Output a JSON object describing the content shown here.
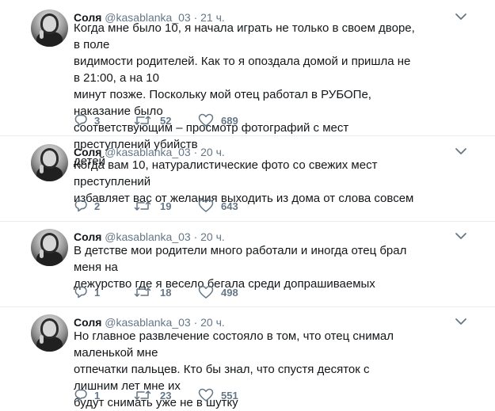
{
  "tweets": [
    {
      "author_name": "Соля",
      "handle": "@kasablanka_03",
      "dot": "·",
      "time": "21 ч.",
      "text": "Когда мне было 10, я начала играть не только в своем дворе, в поле\nвидимости родителей. Как то я опоздала домой и пришла не в 21:00, а на 10\nминут позже. Поскольку мой отец работал в РУБОПе, наказание было\nсоответствующим – просмотр фотографий с мест преступлений убийств\nдетей",
      "replies": "3",
      "retweets": "52",
      "likes": "689"
    },
    {
      "author_name": "Соля",
      "handle": "@kasablanka_03",
      "dot": "·",
      "time": "20 ч.",
      "text": "Когда вам 10, натуралистические фото со свежих мест преступлений\nизбавляет вас от желания выходить из дома от слова совсем",
      "replies": "2",
      "retweets": "19",
      "likes": "643"
    },
    {
      "author_name": "Соля",
      "handle": "@kasablanka_03",
      "dot": "·",
      "time": "20 ч.",
      "text": "В детстве мои родители много работали и иногда отец брал меня на\nдежурство где я весело бегала среди допрашиваемых",
      "replies": "1",
      "retweets": "18",
      "likes": "498"
    },
    {
      "author_name": "Соля",
      "handle": "@kasablanka_03",
      "dot": "·",
      "time": "20 ч.",
      "text": "Но главное развлечение состояло в том, что отец снимал маленькой мне\nотпечатки пальцев. Кто бы знал, что спустя десяток с лишним лет мне их\nбудут снимать уже не в шутку",
      "replies": "1",
      "retweets": "23",
      "likes": "551"
    }
  ],
  "icons": {
    "reply": "reply-icon",
    "retweet": "retweet-icon",
    "like": "like-icon",
    "menu": "chevron-down-icon"
  },
  "colors": {
    "name": "#14171a",
    "secondary": "#657786",
    "separator": "#e6ecf0"
  }
}
